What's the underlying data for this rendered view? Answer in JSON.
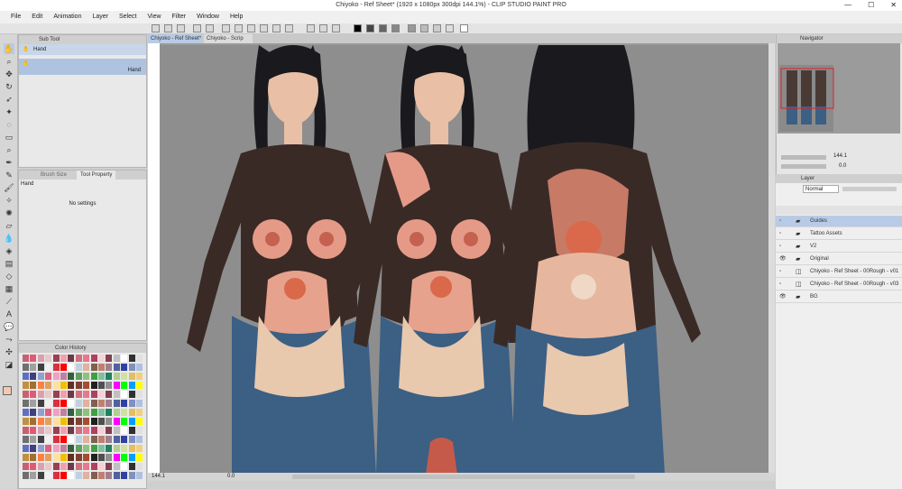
{
  "window": {
    "title": "Chiyoko - Ref Sheet* (1920 x 1080px 300dpi 144.1%) - CLIP STUDIO PAINT PRO",
    "controls": [
      "—",
      "☐",
      "✕"
    ]
  },
  "menu": [
    "File",
    "Edit",
    "Animation",
    "Layer",
    "Select",
    "View",
    "Filter",
    "Window",
    "Help"
  ],
  "sub_tool": {
    "header": "Sub Tool",
    "group_label": "Hand",
    "item_label": "Hand"
  },
  "tool_property": {
    "tabs": [
      "Brush Size",
      "Tool Property"
    ],
    "tool_name": "Hand",
    "settings_text": "No settings"
  },
  "color_history": {
    "header": "Color History"
  },
  "canvas_tabs": [
    "Chiyoko - Ref Sheet*",
    "Chiyoko - Scrip"
  ],
  "status": {
    "zoom": "144.1",
    "rotation": "0.0"
  },
  "navigator": {
    "header": "Navigator",
    "zoom": "144.1",
    "angle": "0.0"
  },
  "layer_panel": {
    "header": "Layer",
    "blend_mode": "Normal",
    "layers": [
      {
        "name": "Guides",
        "type": "folder",
        "visible": false,
        "selected": true
      },
      {
        "name": "Tattoo Assets",
        "type": "folder",
        "visible": false,
        "selected": false
      },
      {
        "name": "V2",
        "type": "folder",
        "visible": false,
        "selected": false
      },
      {
        "name": "Original",
        "type": "folder",
        "visible": true,
        "selected": false
      },
      {
        "name": "Chiyoko - Ref Sheet - 00Rough - v01",
        "type": "raster",
        "visible": false,
        "selected": false
      },
      {
        "name": "Chiyoko - Ref Sheet - 00Rough - v03",
        "type": "raster",
        "visible": false,
        "selected": false
      },
      {
        "name": "BG",
        "type": "folder",
        "visible": true,
        "selected": false
      }
    ]
  },
  "colors": {
    "main_color": "#f2c8b3",
    "sub_color": "#ffffff",
    "accent_blue": "#b8cbe6",
    "palette": [
      "#c86070",
      "#e05a78",
      "#d9a0b0",
      "#e8c8c8",
      "#9a4050",
      "#f0a0b0",
      "#6a3a4a",
      "#d07080",
      "#e87890",
      "#b04060",
      "#f8d0d8",
      "#804050",
      "#c0c0c0",
      "#ffffff",
      "#303030",
      "#e0e0e0",
      "#707070",
      "#a0a0a0",
      "#404040",
      "#f0f0f0",
      "#d83040",
      "#ff0000",
      "#ffffff",
      "#c0d0e0",
      "#e0b0a0",
      "#806050",
      "#c08070",
      "#a08090",
      "#5060a0",
      "#3040a0",
      "#8090c0",
      "#b0c0e0",
      "#6070c0",
      "#404080",
      "#90a0d0",
      "#e06080",
      "#f0a0c0",
      "#c080a0",
      "#306040",
      "#60a060",
      "#90c080",
      "#40a040",
      "#80c0a0",
      "#208060",
      "#b0d090",
      "#d0e0a0",
      "#e0c060",
      "#f0d080",
      "#c09040",
      "#a07030",
      "#ff8040",
      "#e0a060",
      "#ffe0a0",
      "#f0c000",
      "#603020",
      "#804030",
      "#a05030",
      "#202020",
      "#505050",
      "#909090",
      "#ff00ff",
      "#00ff00",
      "#00a0ff",
      "#ffff00"
    ]
  }
}
